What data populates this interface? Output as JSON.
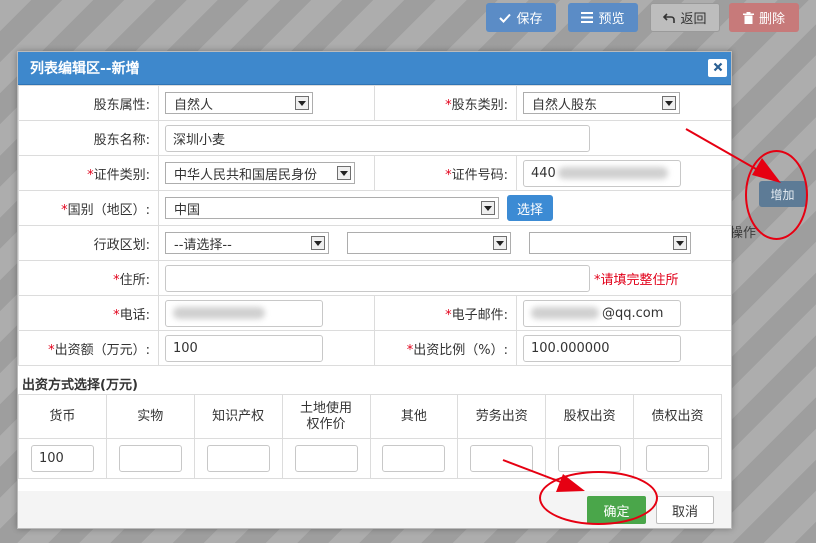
{
  "toolbar": {
    "save": "保存",
    "preview": "预览",
    "back": "返回",
    "delete": "删除"
  },
  "background": {
    "operation_label": "操作",
    "add_button": "增加"
  },
  "dialog": {
    "title": "列表编辑区--新增",
    "fields": {
      "holder_attr": {
        "label": "股东属性:",
        "value": "自然人"
      },
      "holder_type": {
        "label": "股东类别:",
        "value": "自然人股东"
      },
      "holder_name": {
        "label": "股东名称:",
        "value": "深圳小麦"
      },
      "id_type": {
        "label": "证件类别:",
        "value": "中华人民共和国居民身份"
      },
      "id_number": {
        "label": "证件号码:",
        "value": "440"
      },
      "country": {
        "label": "国别（地区）:",
        "value": "中国",
        "button": "选择"
      },
      "region": {
        "label": "行政区划:",
        "value": "--请选择--"
      },
      "address": {
        "label": "住所:",
        "value": "",
        "hint": "请填完整住所"
      },
      "phone": {
        "label": "电话:",
        "value": ""
      },
      "email": {
        "label": "电子邮件:",
        "value": "@qq.com"
      },
      "amount": {
        "label": "出资额（万元）:",
        "value": "100"
      },
      "ratio": {
        "label": "出资比例（%）:",
        "value": "100.000000"
      }
    },
    "contribution": {
      "title": "出资方式选择(万元)",
      "columns": [
        "货币",
        "实物",
        "知识产权",
        "土地使用权作价",
        "其他",
        "劳务出资",
        "股权出资",
        "债权出资"
      ],
      "values": [
        "100",
        "",
        "",
        "",
        "",
        "",
        "",
        ""
      ]
    },
    "confirm": "确定",
    "cancel": "取消"
  },
  "colors": {
    "header_blue": "#3e88cc",
    "required_red": "#e2001a",
    "annotation_red": "#e60012",
    "confirm_green": "#4aa64a"
  }
}
